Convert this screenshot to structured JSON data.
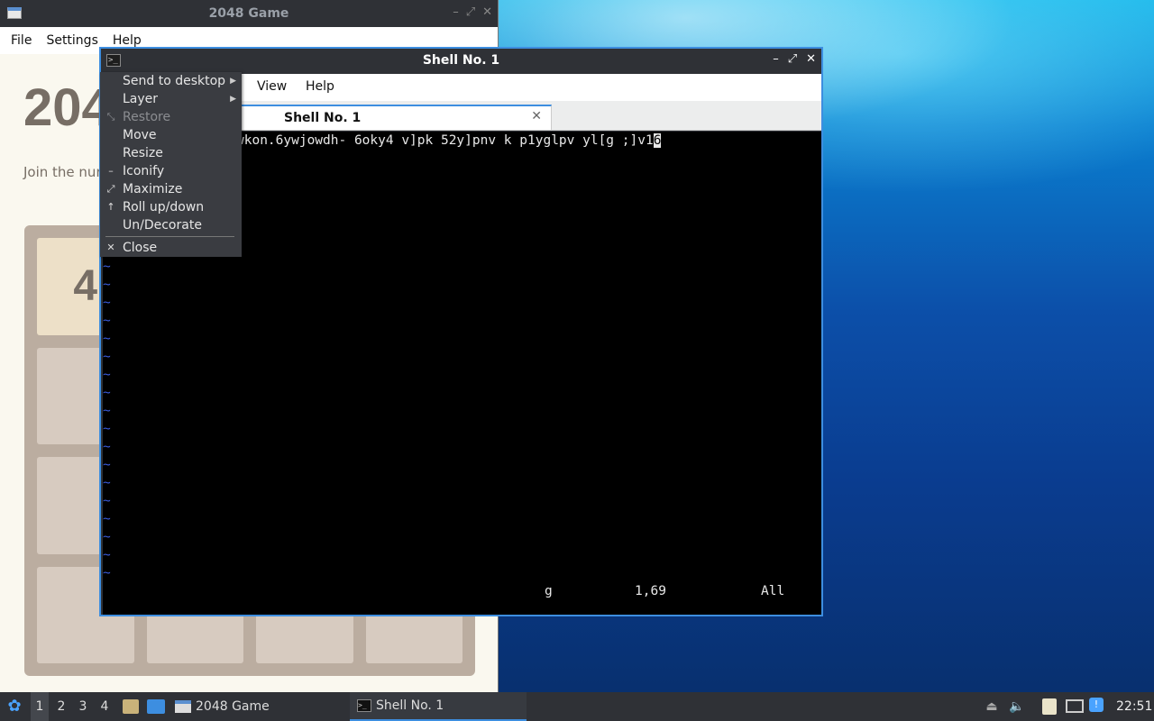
{
  "window_2048": {
    "title": "2048 Game",
    "menu": [
      "File",
      "Settings",
      "Help"
    ],
    "heading": "204",
    "intro": "Join the nur",
    "tile_value": "4"
  },
  "shell": {
    "title": "Shell No. 1",
    "menu": [
      "View",
      "Help"
    ],
    "tab_label": "Shell No. 1",
    "tab_close": "✕",
    "line1": "wkon.6ywjowdh- 6oky4 v]pk 52y]pnv k p1yglpv yl[g ;]v1",
    "cursor_char": "6",
    "tilde": "~",
    "status_cmd": "g",
    "status_pos": "1,69",
    "status_scroll": "All"
  },
  "context_menu": {
    "items": [
      {
        "label": "Send to desktop",
        "icon": "",
        "submenu": true,
        "disabled": false
      },
      {
        "label": "Layer",
        "icon": "",
        "submenu": true,
        "disabled": false
      },
      {
        "label": "Restore",
        "icon": "restore-icon",
        "submenu": false,
        "disabled": true
      },
      {
        "label": "Move",
        "icon": "",
        "submenu": false,
        "disabled": false
      },
      {
        "label": "Resize",
        "icon": "",
        "submenu": false,
        "disabled": false
      },
      {
        "label": "Iconify",
        "icon": "iconify-icon",
        "submenu": false,
        "disabled": false
      },
      {
        "label": "Maximize",
        "icon": "maximize-icon",
        "submenu": false,
        "disabled": false
      },
      {
        "label": "Roll up/down",
        "icon": "rollup-icon",
        "submenu": false,
        "disabled": false
      },
      {
        "label": "Un/Decorate",
        "icon": "",
        "submenu": false,
        "disabled": false
      },
      {
        "label": "Close",
        "icon": "close-icon",
        "submenu": false,
        "disabled": false
      }
    ]
  },
  "taskbar": {
    "desktops": [
      "1",
      "2",
      "3",
      "4"
    ],
    "active_desktop": "1",
    "tasks": [
      {
        "label": "2048 Game",
        "icon": "window-icon"
      },
      {
        "label": "Shell No. 1",
        "icon": "terminal-icon"
      }
    ],
    "clock": "22:51"
  },
  "colors": {
    "accent": "#3d8ee0",
    "panel": "#2f3136",
    "tilde": "#3a5bd9"
  }
}
